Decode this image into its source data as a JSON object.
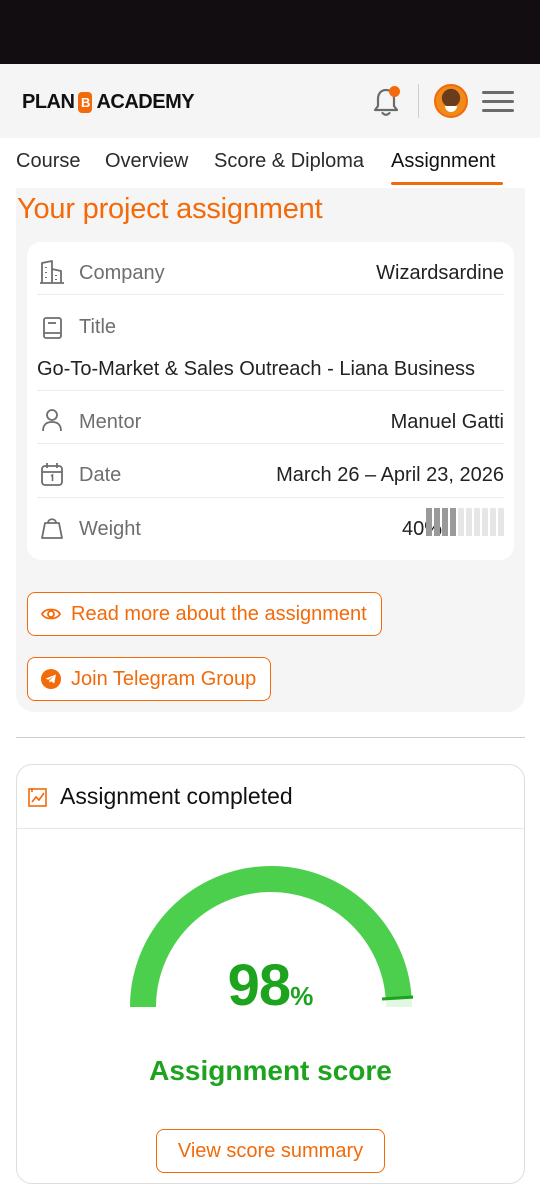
{
  "header": {
    "logo_left": "PLAN",
    "logo_badge": "B",
    "logo_right": "ACADEMY",
    "notification_dot_color": "#f26a0a",
    "accent_color": "#f26a0a"
  },
  "tabs": [
    {
      "label": "Course",
      "active": false
    },
    {
      "label": "Overview",
      "active": false
    },
    {
      "label": "Score & Diploma",
      "active": false
    },
    {
      "label": "Assignment",
      "active": true
    }
  ],
  "assignment": {
    "heading": "Your project assignment",
    "rows": {
      "company": {
        "icon": "building-icon",
        "label": "Company",
        "value": "Wizardsardine"
      },
      "title": {
        "icon": "book-icon",
        "label": "Title",
        "value": "Go-To-Market & Sales Outreach - Liana Business"
      },
      "mentor": {
        "icon": "person-icon",
        "label": "Mentor",
        "value": "Manuel Gatti"
      },
      "date": {
        "icon": "calendar-icon",
        "label": "Date",
        "value": "March 26 – April 23, 2026"
      },
      "weight": {
        "icon": "weight-icon",
        "label": "Weight",
        "value": "40%",
        "level": 0.4
      }
    },
    "read_more_label": "Read more about the assignment",
    "telegram_label": "Join Telegram Group"
  },
  "result": {
    "header_icon": "chart-icon",
    "status": "Assignment completed",
    "score_value": "98",
    "score_unit": "%",
    "score_fraction": 0.98,
    "score_label": "Assignment score",
    "summary_button": "View score summary",
    "gauge_color": "#4ccf4c",
    "score_color": "#1da31d"
  }
}
